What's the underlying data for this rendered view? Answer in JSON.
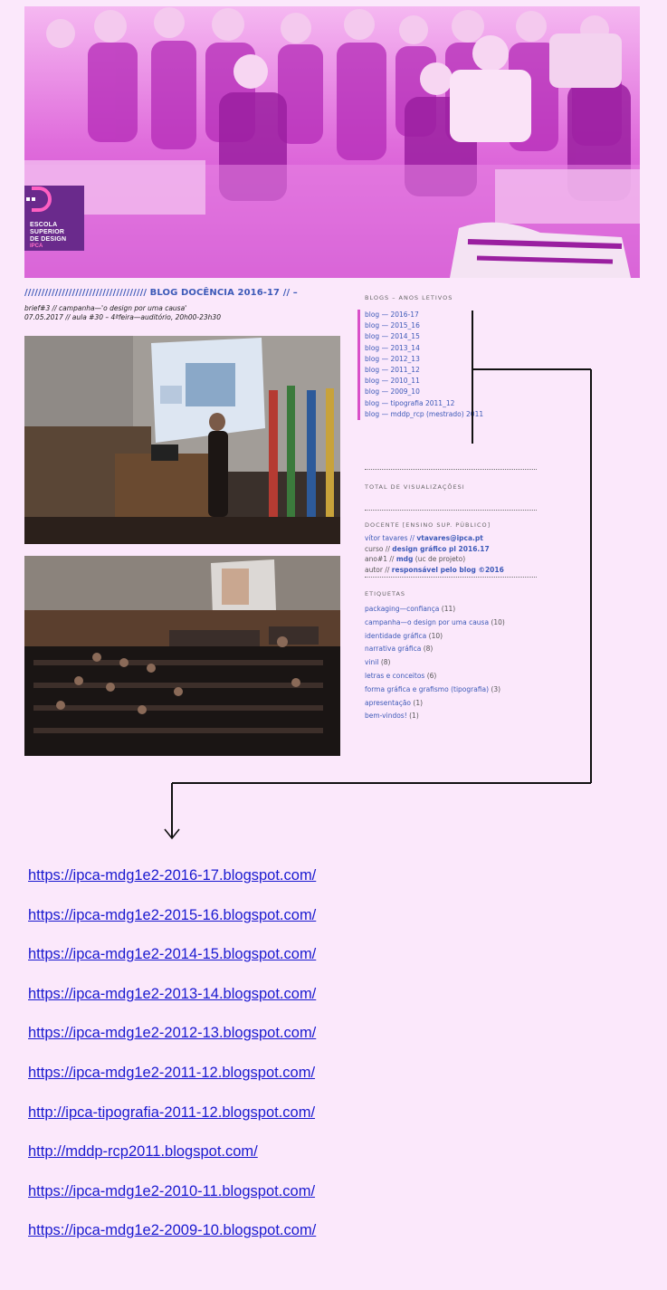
{
  "hero": {
    "logo_text": [
      "ESCOLA",
      "SUPERIOR",
      "DE DESIGN"
    ],
    "logo_sub": "IPCA"
  },
  "blog": {
    "title": "//////////////////////////////////// BLOG DOCÊNCIA 2016-17 // –",
    "brief_line1": "brief#3 // campanha—'o design por uma causa'",
    "brief_line2": "07.05.2017 // aula #30 – 4ªfeira—auditório, 20h00-23h30"
  },
  "sidebar": {
    "blogs_heading": "BLOGS – ANOS LETIVOS",
    "blogs": [
      "blog — 2016-17",
      "blog — 2015_16",
      "blog — 2014_15",
      "blog — 2013_14",
      "blog — 2012_13",
      "blog — 2011_12",
      "blog — 2010_11",
      "blog — 2009_10",
      "blog — tipografia 2011_12",
      "blog — mddp_rcp (mestrado) 2011"
    ],
    "views_heading": "TOTAL DE VISUALIZAÇÕESI",
    "docente_heading": "DOCENTE [ENSINO SUP. PÚBLICO]",
    "docente": {
      "line1_a": "vítor tavares // ",
      "line1_b": "vtavares@ipca.pt",
      "line2_a": "curso // ",
      "line2_b": "design gráfico pl 2016.17",
      "line3_a": "ano#1 // ",
      "line3_b": "mdg",
      "line3_c": " (uc de projeto)",
      "line4_a": "autor // ",
      "line4_b": "responsável pelo blog ©2016"
    },
    "tags_heading": "ETIQUETAS",
    "tags": [
      {
        "name": "packaging—confiança",
        "count": "(11)"
      },
      {
        "name": "campanha—o design por uma causa",
        "count": "(10)"
      },
      {
        "name": "identidade gráfica",
        "count": "(10)"
      },
      {
        "name": "narrativa gráfica",
        "count": "(8)"
      },
      {
        "name": "vinil",
        "count": "(8)"
      },
      {
        "name": "letras e conceitos",
        "count": "(6)"
      },
      {
        "name": "forma gráfica e grafismo (tipografia)",
        "count": "(3)"
      },
      {
        "name": "apresentação",
        "count": "(1)"
      },
      {
        "name": "bem-vindos!",
        "count": "(1)"
      }
    ]
  },
  "links": [
    "https://ipca-mdg1e2-2016-17.blogspot.com/",
    "https://ipca-mdg1e2-2015-16.blogspot.com/",
    "https://ipca-mdg1e2-2014-15.blogspot.com/",
    "https://ipca-mdg1e2-2013-14.blogspot.com/",
    "https://ipca-mdg1e2-2012-13.blogspot.com/",
    "https://ipca-mdg1e2-2011-12.blogspot.com/",
    "http://ipca-tipografia-2011-12.blogspot.com/",
    "http://mddp-rcp2011.blogspot.com/",
    "https://ipca-mdg1e2-2010-11.blogspot.com/",
    "https://ipca-mdg1e2-2009-10.blogspot.com/"
  ],
  "colors": {
    "page_bg": "#fbe8fb",
    "accent_magenta": "#d94fc8",
    "blog_blue": "#3d5ab8",
    "link_blue": "#1a1ad0"
  }
}
